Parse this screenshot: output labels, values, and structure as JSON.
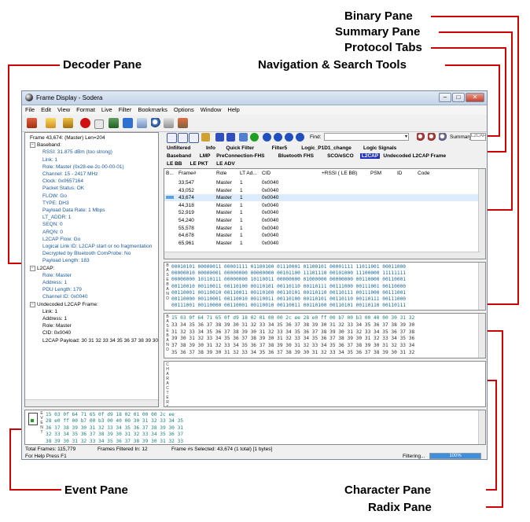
{
  "callouts": {
    "binary": "Binary Pane",
    "summary": "Summary Pane",
    "protocol_tabs": "Protocol Tabs",
    "decoder": "Decoder Pane",
    "nav_search": "Navigation & Search Tools",
    "event": "Event Pane",
    "character": "Character Pane",
    "radix": "Radix Pane"
  },
  "window": {
    "title": "Frame Display - Sodera",
    "menu": [
      "File",
      "Edit",
      "View",
      "Format",
      "Live",
      "Filter",
      "Bookmarks",
      "Options",
      "Window",
      "Help"
    ]
  },
  "decoder": {
    "rows": [
      {
        "text": "Frame 43,674: (Master) Len=204",
        "indent": 0,
        "exp": ""
      },
      {
        "text": "Baseband:",
        "indent": 0,
        "exp": "−"
      },
      {
        "text": "RSSI: 31.875 dBm (too strong)",
        "indent": 2,
        "val": true
      },
      {
        "text": "Link: 1",
        "indent": 2,
        "val": true
      },
      {
        "text": "Role: Master (0x28-ee-2c-00-00-01)",
        "indent": 2,
        "val": true
      },
      {
        "text": "Channel: 15 - 2417 MHz",
        "indent": 2,
        "val": true
      },
      {
        "text": "Clock: 0x0657164",
        "indent": 2,
        "val": true
      },
      {
        "text": "Packet Status: OK",
        "indent": 2,
        "val": true
      },
      {
        "text": "FLOW: Go",
        "indent": 2,
        "val": true
      },
      {
        "text": "TYPE: DH3",
        "indent": 2,
        "val": true
      },
      {
        "text": "Payload Data Rate: 1 Mbps",
        "indent": 2,
        "val": true
      },
      {
        "text": "LT_ADDR: 1",
        "indent": 2,
        "val": true
      },
      {
        "text": "SEQN: 0",
        "indent": 2,
        "val": true
      },
      {
        "text": "ARQN: 0",
        "indent": 2,
        "val": true
      },
      {
        "text": "L2CAP Flow: Go",
        "indent": 2,
        "val": true
      },
      {
        "text": "Logical Link ID: L2CAP start or no fragmentation",
        "indent": 2,
        "val": true
      },
      {
        "text": "Decrypted by Bluetooth ComProbe: No",
        "indent": 2,
        "val": true
      },
      {
        "text": "Payload Length: 183",
        "indent": 2,
        "val": true
      },
      {
        "text": "L2CAP:",
        "indent": 0,
        "exp": "−"
      },
      {
        "text": "Role: Master",
        "indent": 2,
        "val": true
      },
      {
        "text": "Address: 1",
        "indent": 2,
        "val": true
      },
      {
        "text": "PDU Length: 179",
        "indent": 2,
        "val": true
      },
      {
        "text": "Channel ID: 0x0040",
        "indent": 2,
        "val": true
      },
      {
        "text": "Undecoded L2CAP Frame:",
        "indent": 0,
        "exp": "−"
      },
      {
        "text": "Link: 1",
        "indent": 2
      },
      {
        "text": "Address: 1",
        "indent": 2
      },
      {
        "text": "Role: Master",
        "indent": 2
      },
      {
        "text": "CID: 0x0040",
        "indent": 2
      },
      {
        "text": "L2CAP Payload: 30 31 32 33 34 35 36 37 38 39 30 31",
        "indent": 2
      }
    ]
  },
  "nav": {
    "find_label": "Find:",
    "summary_label": "Summary:",
    "summary_value": "L2CAP"
  },
  "tabs": {
    "row1": [
      "Unfiltered",
      "Info",
      "Quick Filter",
      "Filter5",
      "Logic_P1D1_change",
      "Logic Signals"
    ],
    "row2": [
      "Baseband",
      "LMP",
      "PreConnection-FHS",
      "Bluetooth FHS",
      "SCO/eSCO",
      "L2CAP",
      "Undecoded L2CAP Frame"
    ],
    "row3": [
      "LE BB",
      "LE PKT",
      "LE ADV"
    ]
  },
  "summary": {
    "headers": [
      "B...",
      "Frame#",
      "Role",
      "LT Ad...",
      "CID",
      "+RSSI ( LE BB)",
      "PSM",
      "ID",
      "Code"
    ],
    "rows": [
      [
        "33,547",
        "Master",
        "1",
        "0x0040"
      ],
      [
        "43,052",
        "Master",
        "1",
        "0x0040"
      ],
      [
        "43,674",
        "Master",
        "1",
        "0x0040"
      ],
      [
        "44,318",
        "Master",
        "1",
        "0x0040"
      ],
      [
        "52,919",
        "Master",
        "1",
        "0x0040"
      ],
      [
        "54,240",
        "Master",
        "1",
        "0x0040"
      ],
      [
        "55,578",
        "Master",
        "1",
        "0x0040"
      ],
      [
        "64,678",
        "Master",
        "1",
        "0x0040"
      ],
      [
        "65,961",
        "Master",
        "1",
        "0x0040"
      ]
    ],
    "selected_index": 2
  },
  "binary": {
    "side_label": "BASEBAND",
    "lines": [
      "00010101 00000011 00001111 01100100 01110001 01100101 00001111 11011001 00011000",
      "00000010 00000001 00000000 00000000 00101100 11101110 00101000 11100000 11111111",
      "00000000 10110111 00000000 10110011 00000000 01000000 00000000 00110000 00110001",
      "00110010 00110011 00110100 00110101 00110110 00110111 00111000 00111001 00110000",
      "00110001 00110010 00110011 00110100 00110101 00110110 00110111 00111000 00111001",
      "00110000 00110001 00110010 00110011 00110100 00110101 00110110 00110111 00111000",
      "00111001 00110000 00110001 00110010 00110011 00110100 00110101 00110110 00110111"
    ]
  },
  "radix": {
    "side_label": "BASEBAND",
    "lines": [
      [
        "15 03 0f 64 71 65 0f d9 18 02 01 00 00 2c ee 28 e0 ff 00 b7 00 b3 00 40 00 30 31 32",
        "teal"
      ],
      [
        "33 34 35 36 37 38 39 30 31 32 33 34 35 36 37 38 39 30 31 32 33 34 35 36 37 38 39 30",
        "dark"
      ],
      [
        "31 32 33 34 35 36 37 38 39 30 31 32 33 34 35 36 37 38 39 30 31 32 33 34 35 36 37 38",
        "dark"
      ],
      [
        "39 30 31 32 33 34 35 36 37 38 39 30 31 32 33 34 35 36 37 38 39 30 31 32 33 34 35 36",
        "dark"
      ],
      [
        "37 38 39 30 31 32 33 34 35 36 37 38 39 30 31 32 33 34 35 36 37 38 39 30 31 32 33 34",
        "dark"
      ],
      [
        "35 36 37 38 39 30 31 32 33 34 35 36 37 38 39 30 31 32 33 34 35 36 37 38 39 30 31 32",
        "dark"
      ]
    ]
  },
  "character": {
    "side_label": "CHARACTER SPACE"
  },
  "event": {
    "side_label": "EVENT",
    "lines": [
      [
        "15 03 0f 64 71 65 0f d9 18 02 01 00 00 2c ee",
        "teal"
      ],
      [
        "28 e0 ff 00 b7 00 b3 00 40 00 30 31 32 33 34 35",
        "teal"
      ],
      [
        "36 37 38 39 30 31 32 33 34 35 36 37 38 39 30 31",
        "teal"
      ],
      [
        "32 33 34 35 36 37 38 39 30 31 32 33 34 35 36 37",
        "teal"
      ],
      [
        "38 39 30 31 32 33 34 35 36 37 38 39 30 31 32 33",
        "teal"
      ]
    ]
  },
  "status": {
    "total_frames": "Total Frames:  115,779",
    "filtered": "Frames Filtered In:  12",
    "selected": "Frame #s Selected:  43,674 (1 total) [1 bytes]",
    "help": "For Help Press F1",
    "filtering": "Filtering...",
    "progress_label": "100%",
    "progress": 1.0
  }
}
